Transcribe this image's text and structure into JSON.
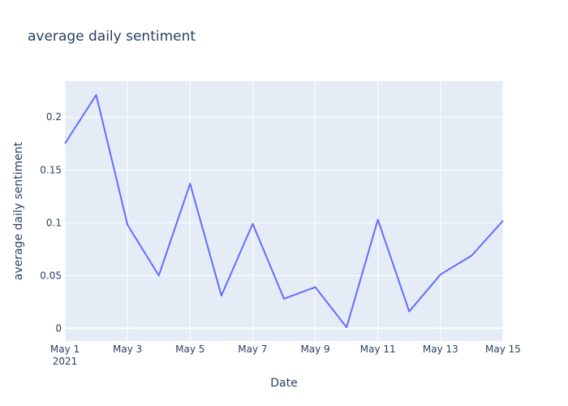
{
  "chart_data": {
    "type": "line",
    "title": "average daily sentiment",
    "xlabel": "Date",
    "ylabel": "average daily sentiment",
    "x": [
      "2021-05-01",
      "2021-05-02",
      "2021-05-03",
      "2021-05-04",
      "2021-05-05",
      "2021-05-06",
      "2021-05-07",
      "2021-05-08",
      "2021-05-09",
      "2021-05-10",
      "2021-05-11",
      "2021-05-12",
      "2021-05-13",
      "2021-05-14",
      "2021-05-15"
    ],
    "series": [
      {
        "values": [
          0.175,
          0.221,
          0.098,
          0.05,
          0.137,
          0.031,
          0.099,
          0.028,
          0.039,
          0.001,
          0.103,
          0.016,
          0.051,
          0.069,
          0.102
        ]
      }
    ],
    "xlim": [
      "2021-05-01",
      "2021-05-15"
    ],
    "ylim": [
      -0.012,
      0.234
    ],
    "x_ticks": [
      {
        "date": "2021-05-01",
        "label": "May 1",
        "sublabel": "2021"
      },
      {
        "date": "2021-05-03",
        "label": "May 3"
      },
      {
        "date": "2021-05-05",
        "label": "May 5"
      },
      {
        "date": "2021-05-07",
        "label": "May 7"
      },
      {
        "date": "2021-05-09",
        "label": "May 9"
      },
      {
        "date": "2021-05-11",
        "label": "May 11"
      },
      {
        "date": "2021-05-13",
        "label": "May 13"
      },
      {
        "date": "2021-05-15",
        "label": "May 15"
      }
    ],
    "y_ticks": [
      {
        "value": 0,
        "label": "0"
      },
      {
        "value": 0.05,
        "label": "0.05"
      },
      {
        "value": 0.1,
        "label": "0.1"
      },
      {
        "value": 0.15,
        "label": "0.15"
      },
      {
        "value": 0.2,
        "label": "0.2"
      }
    ],
    "grid": true,
    "colors": {
      "line": "#636efa",
      "plot_bg": "#e5ecf6",
      "grid": "#ffffff",
      "text": "#2a3f5f"
    }
  }
}
